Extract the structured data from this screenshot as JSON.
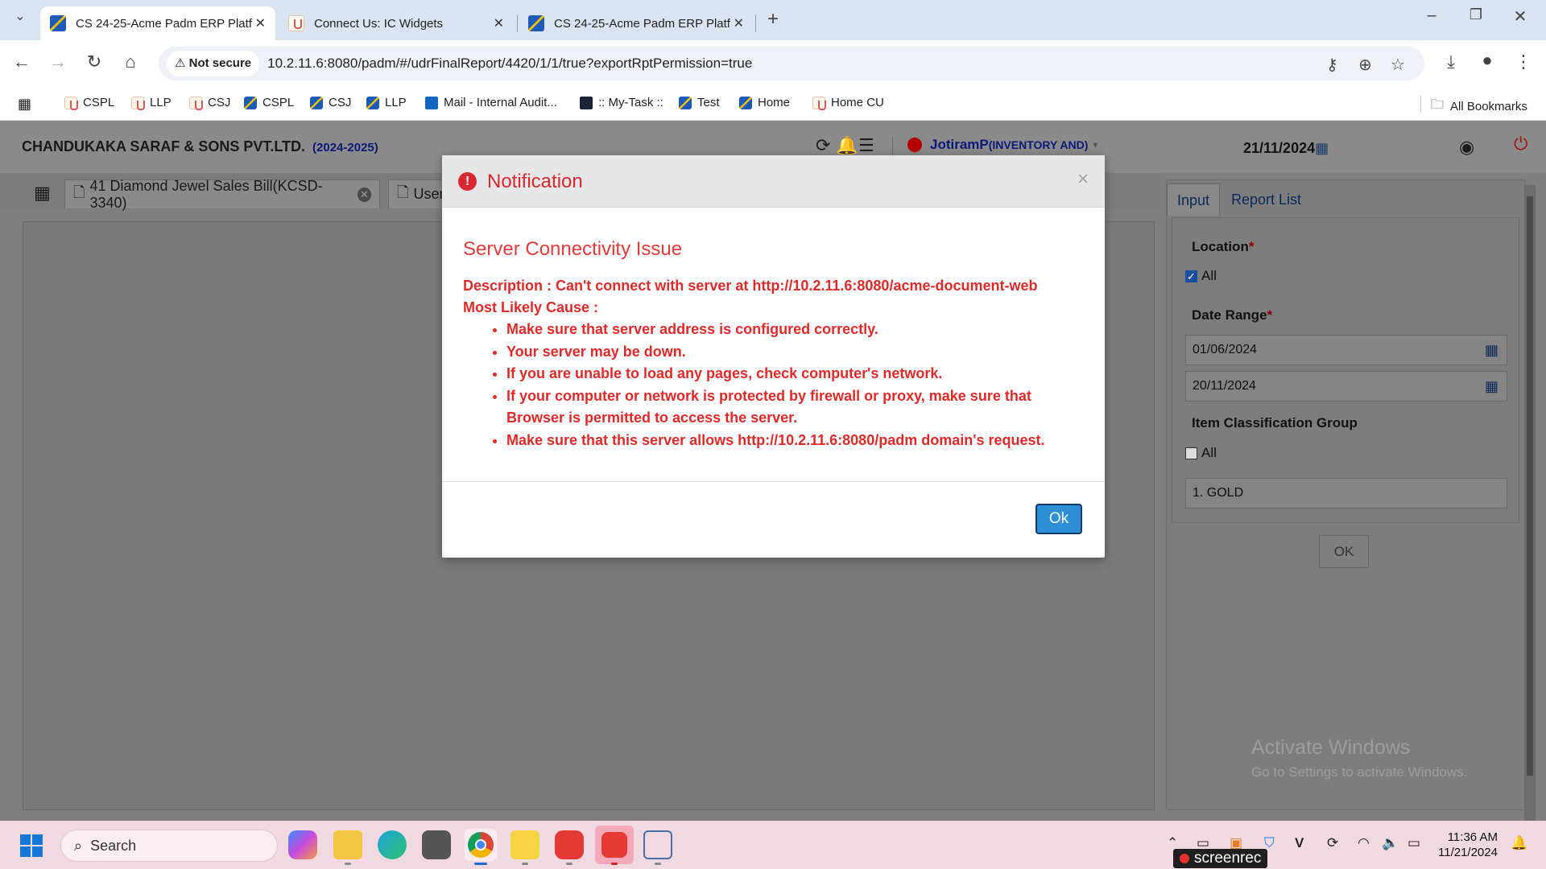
{
  "browser": {
    "tabs": [
      {
        "title": "CS 24-25-Acme Padm ERP Platf",
        "active": true,
        "icon": "acme-favicon"
      },
      {
        "title": "Connect Us: IC Widgets",
        "active": false,
        "icon": "ic-favicon"
      },
      {
        "title": "CS 24-25-Acme Padm ERP Platf",
        "active": false,
        "icon": "acme-favicon"
      }
    ],
    "security_label": "Not secure",
    "url": "10.2.11.6:8080/padm/#/udrFinalReport/4420/1/1/true?exportRptPermission=true",
    "bookmarks": [
      {
        "label": "CSPL",
        "icon": "ic-favicon"
      },
      {
        "label": "LLP",
        "icon": "ic-favicon"
      },
      {
        "label": "CSJ",
        "icon": "ic-favicon"
      },
      {
        "label": "CSPL",
        "icon": "acme-favicon"
      },
      {
        "label": "CSJ",
        "icon": "acme-favicon"
      },
      {
        "label": "LLP",
        "icon": "acme-favicon"
      },
      {
        "label": "Mail - Internal Audit...",
        "icon": "outlook-icon"
      },
      {
        "label": ":: My-Task ::",
        "icon": "react-icon"
      },
      {
        "label": "Test",
        "icon": "acme-favicon"
      },
      {
        "label": "Home",
        "icon": "acme-favicon"
      },
      {
        "label": "Home CU",
        "icon": "ic-favicon"
      }
    ],
    "all_bookmarks": "All Bookmarks"
  },
  "app": {
    "company": "CHANDUKAKA SARAF & SONS PVT.LTD.",
    "financial_year": "(2024-2025)",
    "user": "JotiramP",
    "role": "(INVENTORY AND)",
    "date": "21/11/2024",
    "tabs": [
      {
        "label": "41 Diamond Jewel Sales Bill(KCSD-3340)"
      },
      {
        "label": "User"
      }
    ],
    "side_tabs": {
      "input": "Input",
      "report_list": "Report List"
    },
    "form": {
      "location_label": "Location",
      "location_all": "All",
      "location_all_checked": true,
      "date_range_label": "Date Range",
      "from_date": "01/06/2024",
      "to_date": "20/11/2024",
      "item_group_label": "Item Classification Group",
      "item_group_all": "All",
      "item_group_all_checked": false,
      "item_group_value": "1. GOLD",
      "ok_label": "OK"
    },
    "required_mark": "*"
  },
  "modal": {
    "title": "Notification",
    "close": "×",
    "heading": "Server Connectivity Issue",
    "description": "Description : Can't connect with server at http://10.2.11.6:8080/acme-document-web",
    "cause_label": "Most Likely Cause :",
    "causes": [
      "Make sure that server address is configured correctly.",
      "Your server may be down.",
      "If you are unable to load any pages, check computer's network.",
      "If your computer or network is protected by firewall or proxy, make sure that Browser is permitted to access the server.",
      "Make sure that this server allows http://10.2.11.6:8080/padm domain's request."
    ],
    "ok_label": "Ok"
  },
  "watermark": {
    "line1": "Activate Windows",
    "line2": "Go to Settings to activate Windows."
  },
  "taskbar": {
    "search_placeholder": "Search",
    "time": "11:36 AM",
    "date": "11/21/2024",
    "screenrec_label": "screenrec"
  },
  "colors": {
    "accent_error": "#d9282f",
    "ok_button": "#2d8fd5",
    "company_year": "#0b1a7a"
  }
}
